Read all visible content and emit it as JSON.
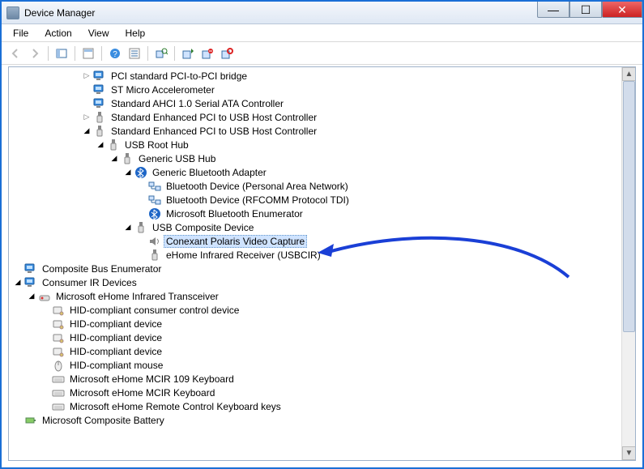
{
  "window": {
    "title": "Device Manager"
  },
  "menu": {
    "file": "File",
    "action": "Action",
    "view": "View",
    "help": "Help"
  },
  "tree": {
    "n0": "PCI standard PCI-to-PCI bridge",
    "n1": "ST Micro Accelerometer",
    "n2": "Standard AHCI 1.0 Serial ATA Controller",
    "n3": "Standard Enhanced PCI to USB Host Controller",
    "n4": "Standard Enhanced PCI to USB Host Controller",
    "n5": "USB Root Hub",
    "n6": "Generic USB Hub",
    "n7": "Generic Bluetooth Adapter",
    "n8": "Bluetooth Device (Personal Area Network)",
    "n9": "Bluetooth Device (RFCOMM Protocol TDI)",
    "n10": "Microsoft Bluetooth Enumerator",
    "n11": "USB Composite Device",
    "n12": "Conexant Polaris Video Capture",
    "n13": "eHome Infrared Receiver (USBCIR)",
    "n14": "Composite Bus Enumerator",
    "n15": "Consumer IR Devices",
    "n16": "Microsoft eHome Infrared Transceiver",
    "n17": "HID-compliant consumer control device",
    "n18": "HID-compliant device",
    "n19": "HID-compliant device",
    "n20": "HID-compliant device",
    "n21": "HID-compliant mouse",
    "n22": "Microsoft eHome MCIR 109 Keyboard",
    "n23": "Microsoft eHome MCIR Keyboard",
    "n24": "Microsoft eHome Remote Control Keyboard keys",
    "n25": "Microsoft Composite Battery"
  },
  "annotation": {
    "target": "Conexant Polaris Video Capture"
  }
}
